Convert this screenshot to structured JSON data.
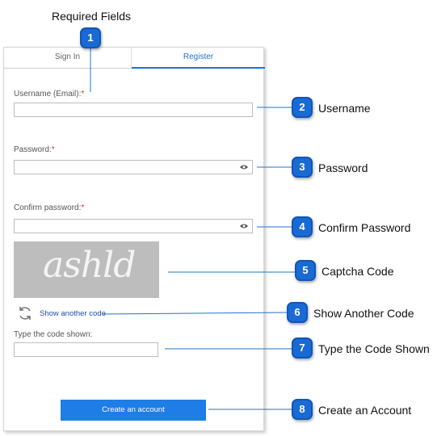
{
  "caption": {
    "required_fields": "Required Fields"
  },
  "tabs": {
    "signin": "Sign In",
    "register": "Register"
  },
  "form": {
    "username_label": "Username (Email):",
    "password_label": "Password:",
    "confirm_label": "Confirm password:",
    "required_mark": "*",
    "captcha_text": "ashld",
    "show_another_code": "Show another code",
    "type_code_label": "Type the code shown:",
    "create_button": "Create an account"
  },
  "callouts": [
    {
      "num": "1",
      "label": ""
    },
    {
      "num": "2",
      "label": "Username"
    },
    {
      "num": "3",
      "label": "Password"
    },
    {
      "num": "4",
      "label": "Confirm Password"
    },
    {
      "num": "5",
      "label": "Captcha Code"
    },
    {
      "num": "6",
      "label": "Show Another Code"
    },
    {
      "num": "7",
      "label": "Type the Code Shown"
    },
    {
      "num": "8",
      "label": "Create an Account"
    }
  ],
  "colors": {
    "accent": "#1f74c9",
    "callout": "#1a6ad4",
    "button": "#1f7de6",
    "required": "#c0392b"
  }
}
